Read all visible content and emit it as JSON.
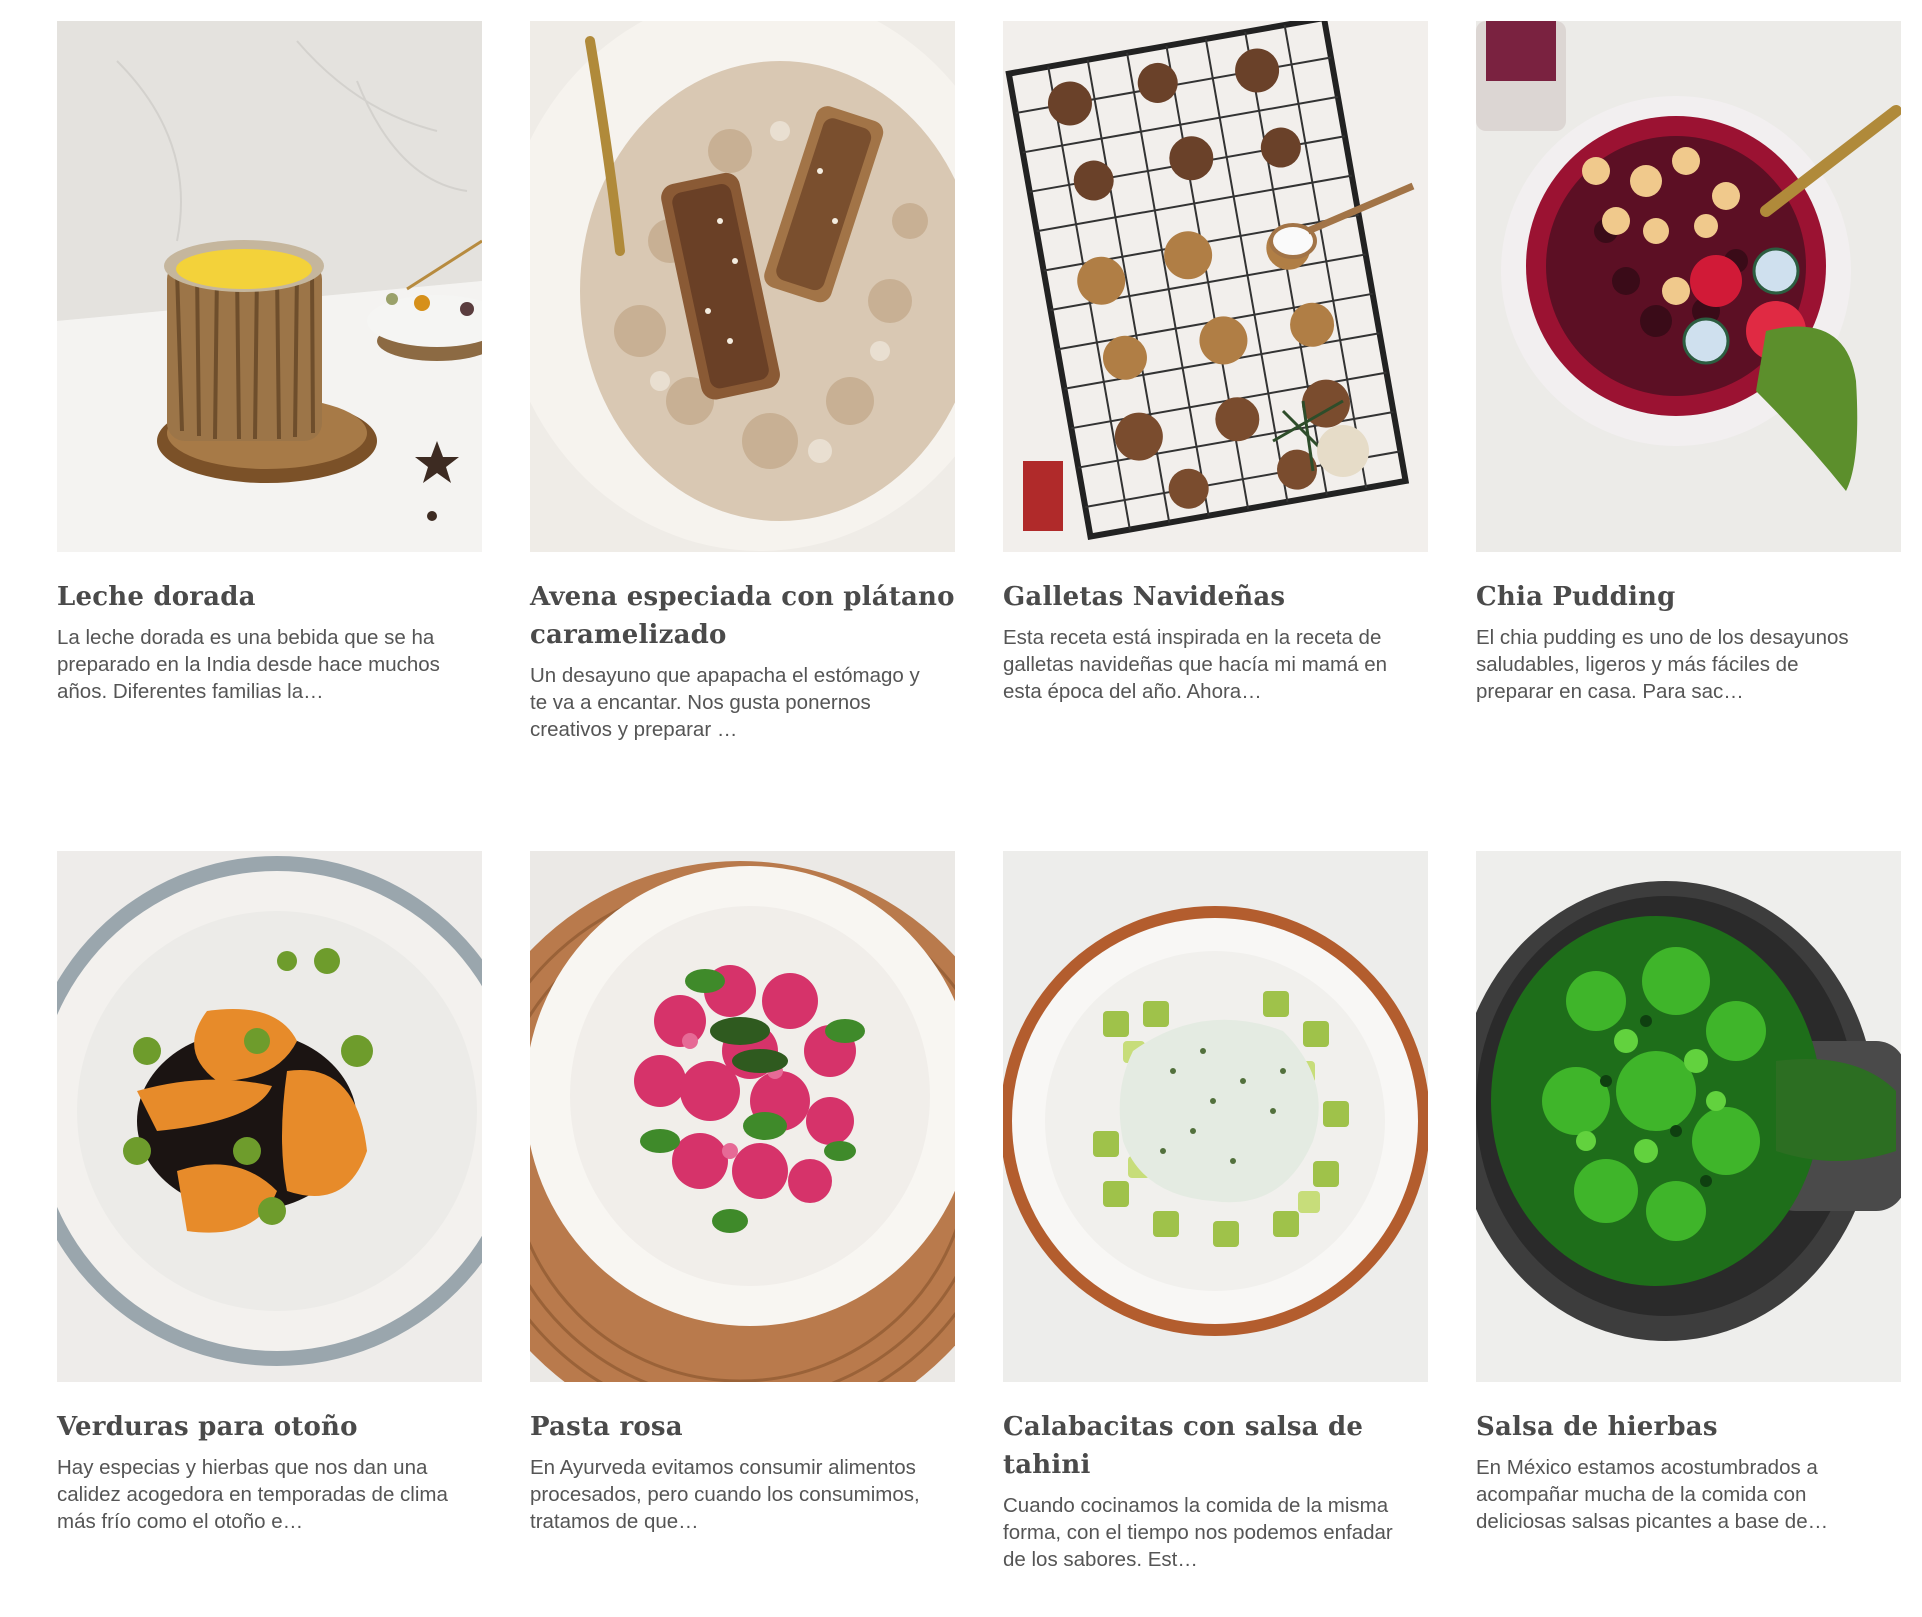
{
  "recipes": [
    {
      "title": "Leche dorada",
      "excerpt": "La leche dorada es una bebida que se ha preparado en la India desde hace muchos años. Diferentes familias la…",
      "image": "golden-milk-photo"
    },
    {
      "title": "Avena especiada con plátano caramelizado",
      "excerpt": "Un desayuno que apapacha el estómago y te va a encantar. Nos gusta ponernos creativos y preparar …",
      "image": "spiced-oatmeal-photo"
    },
    {
      "title": "Galletas Navideñas",
      "excerpt": "Esta receta está inspirada en la receta de galletas navideñas que hacía mi mamá en esta época del año. Ahora…",
      "image": "christmas-cookies-photo"
    },
    {
      "title": "Chia Pudding",
      "excerpt": "El chia pudding es uno de los desayunos saludables, ligeros y más fáciles de preparar en casa. Para sac…",
      "image": "chia-pudding-photo"
    },
    {
      "title": "Verduras para otoño",
      "excerpt": "Hay especias y hierbas que nos dan una calidez acogedora en temporadas de clima más frío como el otoño e…",
      "image": "autumn-vegetables-photo"
    },
    {
      "title": "Pasta rosa",
      "excerpt": "En Ayurveda evitamos consumir alimentos procesados, pero cuando los consumimos, tratamos de que…",
      "image": "pink-pasta-photo"
    },
    {
      "title": "Calabacitas con salsa de tahini",
      "excerpt": "Cuando cocinamos la comida de la misma forma, con el tiempo nos podemos enfadar de los sabores. Est…",
      "image": "zucchini-tahini-photo"
    },
    {
      "title": "Salsa de hierbas",
      "excerpt": "En México estamos acostumbrados a acompañar mucha de la comida con deliciosas salsas picantes a base de…",
      "image": "herb-salsa-photo"
    }
  ]
}
